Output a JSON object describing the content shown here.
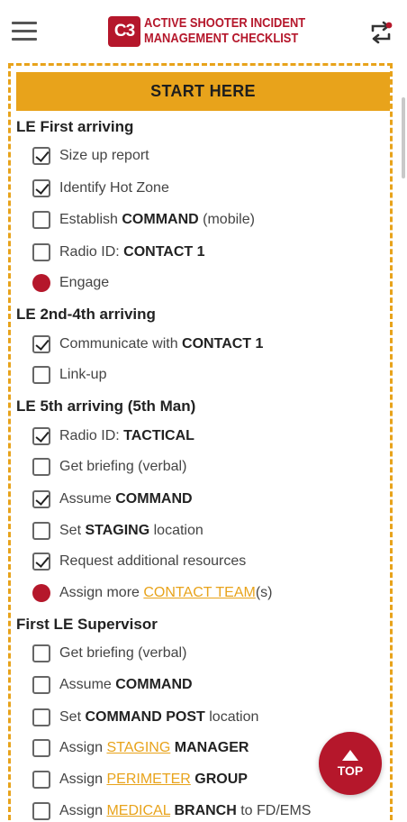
{
  "header": {
    "logo_text": "C3",
    "title_line1": "ACTIVE SHOOTER INCIDENT",
    "title_line2": "MANAGEMENT CHECKLIST",
    "menu_icon": "hamburger-menu-icon",
    "sync_icon": "sync-icon"
  },
  "start_label": "START HERE",
  "sections": [
    {
      "title": "LE First arriving",
      "items": [
        {
          "state": "checked",
          "parts": [
            {
              "t": "Size up report"
            }
          ]
        },
        {
          "state": "checked",
          "parts": [
            {
              "t": "Identify Hot Zone"
            }
          ]
        },
        {
          "state": "unchecked",
          "parts": [
            {
              "t": "Establish "
            },
            {
              "t": "COMMAND",
              "b": true
            },
            {
              "t": " (mobile)"
            }
          ]
        },
        {
          "state": "unchecked",
          "parts": [
            {
              "t": "Radio ID: "
            },
            {
              "t": "CONTACT 1",
              "b": true
            }
          ]
        },
        {
          "state": "dot",
          "parts": [
            {
              "t": "Engage"
            }
          ]
        }
      ]
    },
    {
      "title": "LE 2nd-4th arriving",
      "items": [
        {
          "state": "checked",
          "parts": [
            {
              "t": "Communicate with "
            },
            {
              "t": "CONTACT 1",
              "b": true
            }
          ]
        },
        {
          "state": "unchecked",
          "parts": [
            {
              "t": "Link-up"
            }
          ]
        }
      ]
    },
    {
      "title": "LE 5th arriving (5th Man)",
      "items": [
        {
          "state": "checked",
          "parts": [
            {
              "t": "Radio ID: "
            },
            {
              "t": "TACTICAL",
              "b": true
            }
          ]
        },
        {
          "state": "unchecked",
          "parts": [
            {
              "t": "Get briefing (verbal)"
            }
          ]
        },
        {
          "state": "checked",
          "parts": [
            {
              "t": "Assume "
            },
            {
              "t": "COMMAND",
              "b": true
            }
          ]
        },
        {
          "state": "unchecked",
          "parts": [
            {
              "t": "Set "
            },
            {
              "t": "STAGING",
              "b": true
            },
            {
              "t": " location"
            }
          ]
        },
        {
          "state": "checked",
          "parts": [
            {
              "t": "Request additional resources"
            }
          ]
        },
        {
          "state": "dot",
          "parts": [
            {
              "t": "Assign more "
            },
            {
              "t": "CONTACT TEAM",
              "link": true
            },
            {
              "t": "(s)"
            }
          ]
        }
      ]
    },
    {
      "title": "First LE Supervisor",
      "items": [
        {
          "state": "unchecked",
          "parts": [
            {
              "t": "Get briefing (verbal)"
            }
          ]
        },
        {
          "state": "unchecked",
          "parts": [
            {
              "t": "Assume "
            },
            {
              "t": "COMMAND",
              "b": true
            }
          ]
        },
        {
          "state": "unchecked",
          "parts": [
            {
              "t": "Set "
            },
            {
              "t": "COMMAND POST",
              "b": true
            },
            {
              "t": " location"
            }
          ]
        },
        {
          "state": "unchecked",
          "parts": [
            {
              "t": "Assign "
            },
            {
              "t": "STAGING",
              "link": true
            },
            {
              "t": " "
            },
            {
              "t": "MANAGER",
              "b": true
            }
          ]
        },
        {
          "state": "unchecked",
          "parts": [
            {
              "t": "Assign "
            },
            {
              "t": "PERIMETER",
              "link": true
            },
            {
              "t": " "
            },
            {
              "t": "GROUP",
              "b": true
            }
          ]
        },
        {
          "state": "unchecked",
          "parts": [
            {
              "t": "Assign "
            },
            {
              "t": "MEDICAL",
              "link": true
            },
            {
              "t": " "
            },
            {
              "t": "BRANCH",
              "b": true
            },
            {
              "t": " to FD/EMS"
            }
          ]
        }
      ]
    }
  ],
  "top_button_label": "TOP",
  "colors": {
    "brand_red": "#b5172b",
    "accent_orange": "#e8a31b"
  }
}
